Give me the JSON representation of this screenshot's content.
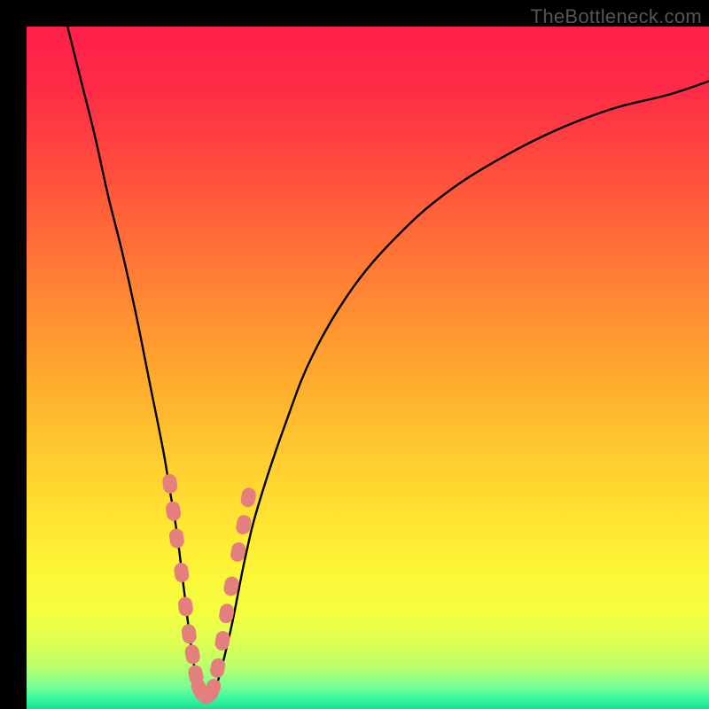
{
  "watermark": "TheBottleneck.com",
  "colors": {
    "gradient_stops": [
      {
        "offset": 0.0,
        "color": "#ff1f4a"
      },
      {
        "offset": 0.09,
        "color": "#ff2b46"
      },
      {
        "offset": 0.2,
        "color": "#ff4a3e"
      },
      {
        "offset": 0.33,
        "color": "#ff7335"
      },
      {
        "offset": 0.45,
        "color": "#ff9730"
      },
      {
        "offset": 0.57,
        "color": "#ffba2e"
      },
      {
        "offset": 0.68,
        "color": "#ffd930"
      },
      {
        "offset": 0.78,
        "color": "#fff235"
      },
      {
        "offset": 0.86,
        "color": "#f4ff40"
      },
      {
        "offset": 0.91,
        "color": "#d8ff55"
      },
      {
        "offset": 0.94,
        "color": "#b6ff70"
      },
      {
        "offset": 0.965,
        "color": "#7fff90"
      },
      {
        "offset": 0.985,
        "color": "#38f7a0"
      },
      {
        "offset": 1.0,
        "color": "#19e08f"
      }
    ],
    "curve": "#000000",
    "marker_fill": "#e37f7d",
    "marker_stroke": "#d86f6c"
  },
  "chart_data": {
    "type": "line",
    "title": "",
    "xlabel": "",
    "ylabel": "",
    "xlim": [
      0,
      100
    ],
    "ylim": [
      0,
      100
    ],
    "grid": false,
    "series": [
      {
        "name": "bottleneck-curve",
        "x": [
          6,
          8,
          10,
          12,
          14,
          16,
          18,
          20,
          21,
          22,
          23,
          24,
          25,
          26,
          27,
          28,
          30,
          32,
          34,
          38,
          42,
          48,
          55,
          62,
          70,
          78,
          86,
          94,
          100
        ],
        "y": [
          100,
          92,
          84,
          75,
          67,
          58,
          48,
          38,
          32,
          26,
          18,
          10,
          4,
          2,
          2,
          4,
          12,
          22,
          30,
          42,
          52,
          62,
          70,
          76,
          81,
          85,
          88,
          90,
          92
        ]
      }
    ],
    "markers": {
      "name": "highlight-points",
      "points": [
        {
          "x": 21.0,
          "y": 33
        },
        {
          "x": 21.5,
          "y": 29
        },
        {
          "x": 22.0,
          "y": 25
        },
        {
          "x": 22.7,
          "y": 20
        },
        {
          "x": 23.3,
          "y": 15
        },
        {
          "x": 23.8,
          "y": 11
        },
        {
          "x": 24.3,
          "y": 8
        },
        {
          "x": 24.8,
          "y": 5
        },
        {
          "x": 25.3,
          "y": 3
        },
        {
          "x": 26.0,
          "y": 2
        },
        {
          "x": 26.7,
          "y": 2
        },
        {
          "x": 27.3,
          "y": 3
        },
        {
          "x": 28.0,
          "y": 6
        },
        {
          "x": 28.7,
          "y": 10
        },
        {
          "x": 29.3,
          "y": 14
        },
        {
          "x": 30.0,
          "y": 18
        },
        {
          "x": 31.0,
          "y": 23
        },
        {
          "x": 31.8,
          "y": 27
        },
        {
          "x": 32.5,
          "y": 31
        }
      ]
    }
  }
}
